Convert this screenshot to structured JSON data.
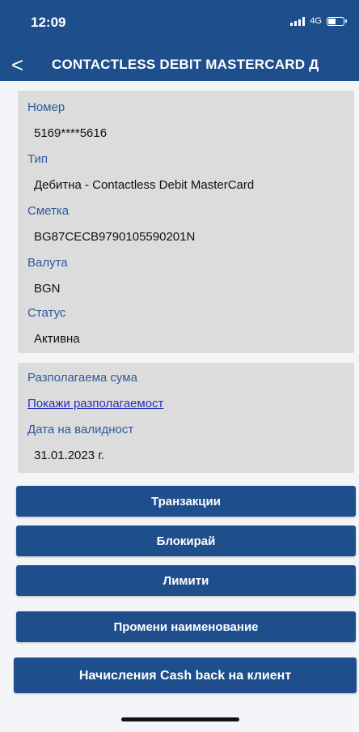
{
  "status_bar": {
    "time": "12:09",
    "network": "4G",
    "icons": [
      "signal-bars-icon",
      "battery-icon"
    ]
  },
  "header": {
    "back_icon": "chevron-left-icon",
    "back_glyph": "<",
    "title": "CONTACTLESS DEBIT MASTERCARD Д"
  },
  "card_details": {
    "number_label": "Номер",
    "number_value": "5169****5616",
    "type_label": "Тип",
    "type_value": "Дебитна - Contactless Debit MasterCard",
    "account_label": "Сметка",
    "account_value": "BG87CECB9790105590201N",
    "currency_label": "Валута",
    "currency_value": "BGN",
    "status_label": "Статус",
    "status_value": "Активна"
  },
  "availability": {
    "available_label": "Разполагаема сума",
    "available_link": "Покажи разполагаемост",
    "validity_label": "Дата на валидност",
    "validity_value": "31.01.2023 г."
  },
  "actions": {
    "transactions": "Транзакции",
    "block": "Блокирай",
    "limits": "Лимити",
    "rename": "Промени наименование",
    "cashback": "Начисления Cash back на клиент"
  },
  "colors": {
    "brand_blue": "#1e4f8c",
    "label_blue": "#2d5a9a",
    "link_blue": "#2730b8",
    "card_gray": "#dcdcdc"
  }
}
